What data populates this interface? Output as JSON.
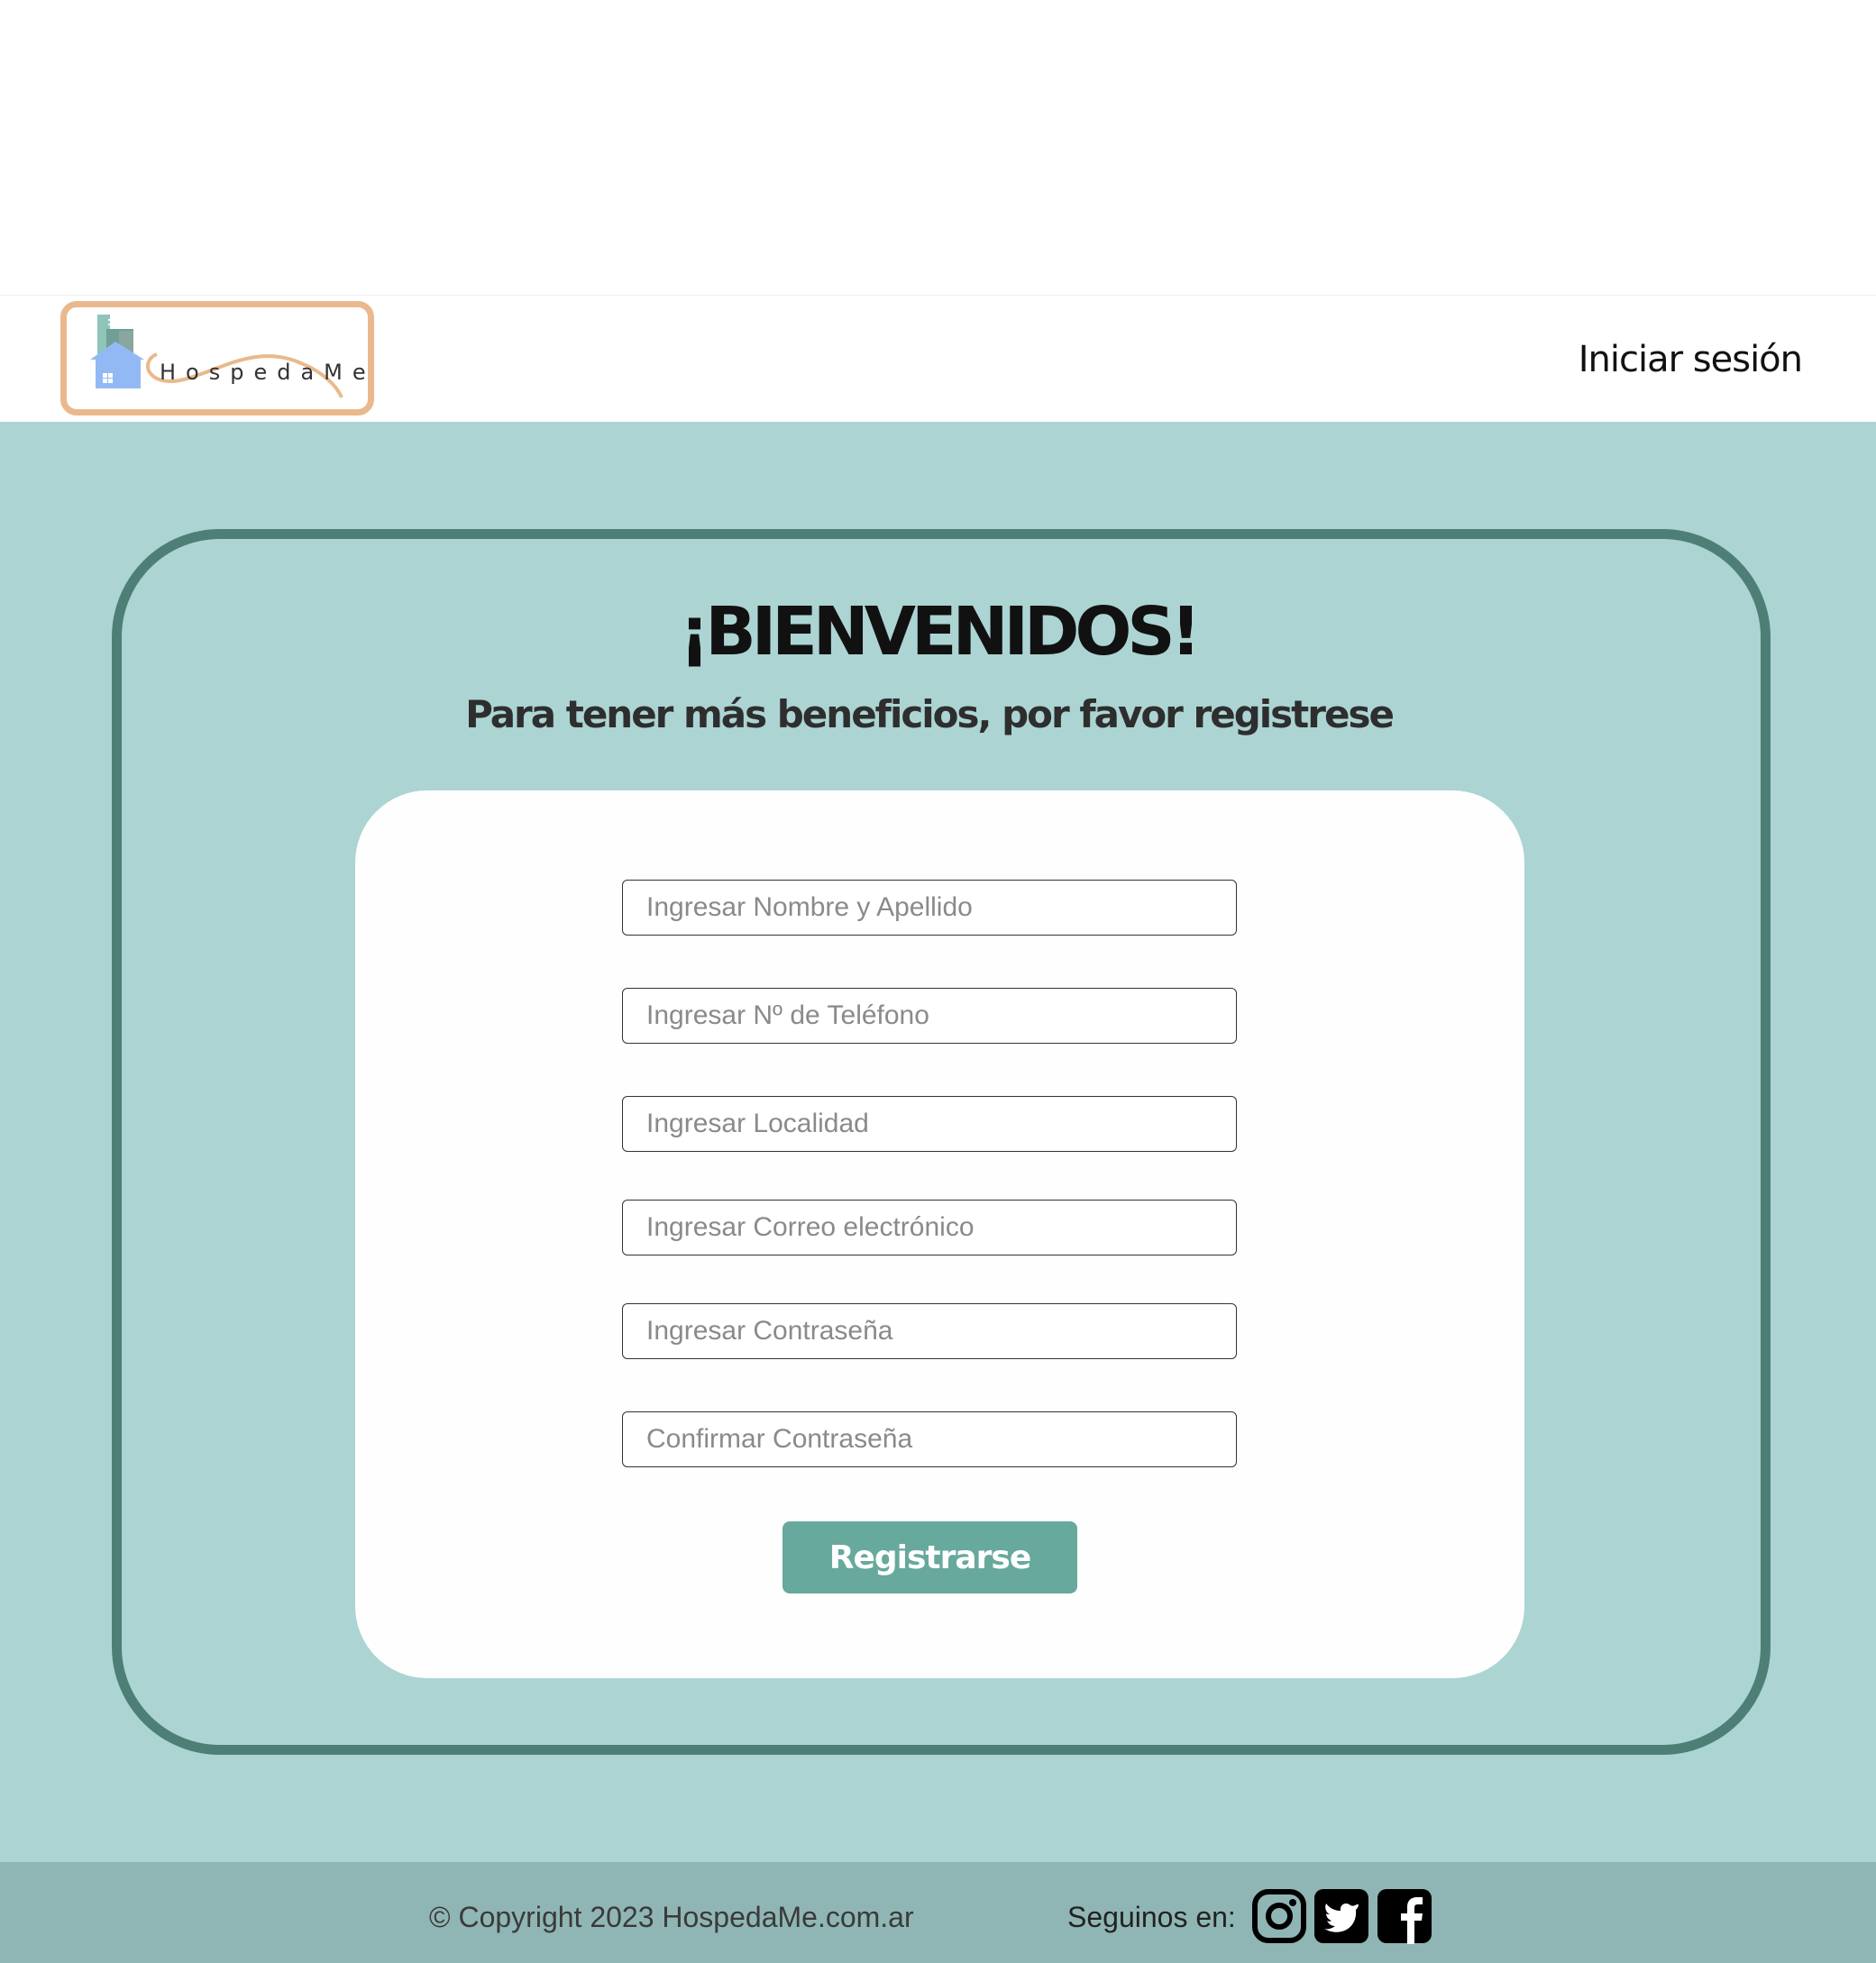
{
  "header": {
    "logo_text": "HospedaMe",
    "login_label": "Iniciar sesión"
  },
  "main": {
    "title": "¡BIENVENIDOS!",
    "subtitle": "Para tener más beneficios, por favor registrese",
    "form": {
      "name_placeholder": "Ingresar Nombre y Apellido",
      "phone_placeholder": "Ingresar Nº de Teléfono",
      "city_placeholder": "Ingresar Localidad",
      "email_placeholder": "Ingresar Correo electrónico",
      "password_placeholder": "Ingresar Contraseña",
      "confirm_placeholder": "Confirmar Contraseña",
      "submit_label": "Registrarse"
    }
  },
  "footer": {
    "copyright": "© Copyright 2023 HospedaMe.com.ar",
    "follow_label": "Seguinos en:",
    "social": [
      "instagram-icon",
      "twitter-icon",
      "facebook-icon"
    ]
  },
  "colors": {
    "background": "#acd4d3",
    "frame": "#4e7f76",
    "button": "#67a99c",
    "logo_border": "#e9b98d",
    "footer": "#8fb6b4"
  }
}
